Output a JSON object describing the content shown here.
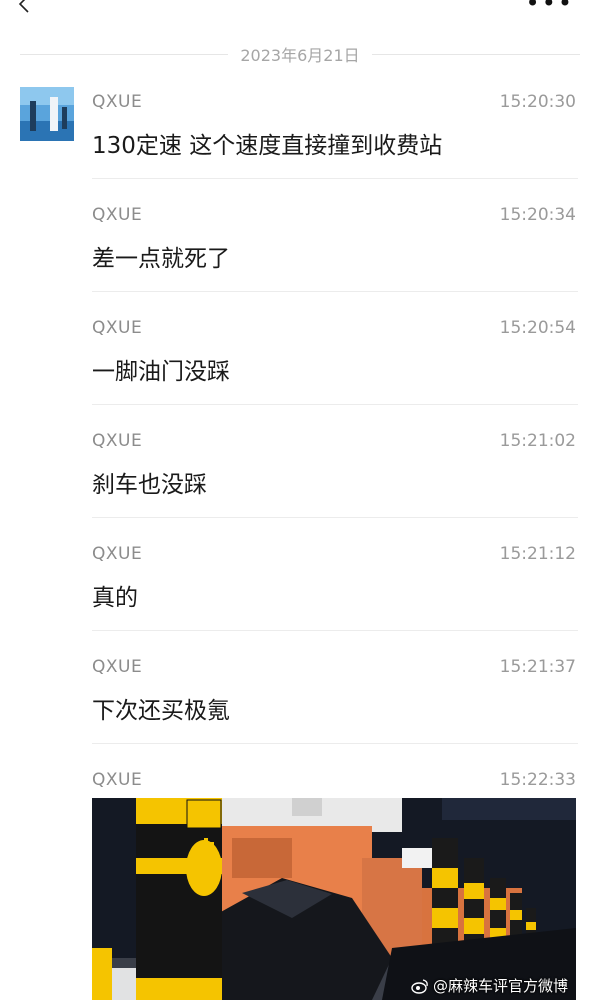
{
  "header": {
    "back_icon": "chevron-left-icon",
    "more_icon": "more-dots-icon"
  },
  "date_separator": "2023年6月21日",
  "messages": [
    {
      "sender": "QXUE",
      "time": "15:20:30",
      "text": "130定速 这个速度直接撞到收费站"
    },
    {
      "sender": "QXUE",
      "time": "15:20:34",
      "text": "差一点就死了"
    },
    {
      "sender": "QXUE",
      "time": "15:20:54",
      "text": "一脚油门没踩"
    },
    {
      "sender": "QXUE",
      "time": "15:21:02",
      "text": "刹车也没踩"
    },
    {
      "sender": "QXUE",
      "time": "15:21:12",
      "text": "真的"
    },
    {
      "sender": "QXUE",
      "time": "15:21:37",
      "text": "下次还买极氪"
    },
    {
      "sender": "QXUE",
      "time": "15:22:33",
      "image": "photo-toll-station-crash"
    }
  ],
  "watermark": "@麻辣车评官方微博",
  "colors": {
    "background": "#ffffff",
    "meta_text": "#8c8c8c",
    "divider": "#ececec",
    "safety_yellow": "#f5c400",
    "toll_orange": "#e8804a"
  }
}
